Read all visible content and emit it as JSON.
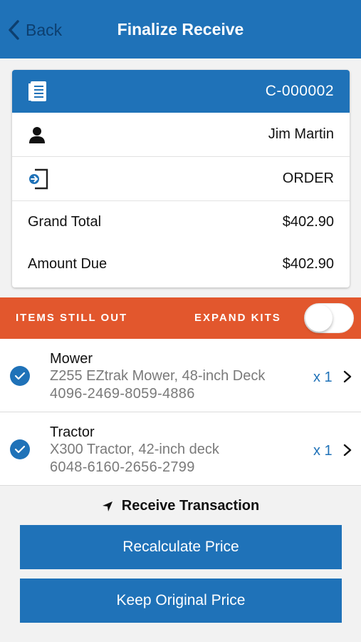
{
  "nav": {
    "back_label": "Back",
    "title": "Finalize Receive"
  },
  "summary": {
    "contract_number": "C-000002",
    "customer_name": "Jim Martin",
    "transaction_type": "ORDER",
    "grand_total_label": "Grand Total",
    "grand_total_value": "$402.90",
    "amount_due_label": "Amount Due",
    "amount_due_value": "$402.90",
    "icons": [
      "document-icon",
      "person-icon",
      "sign-in-icon"
    ]
  },
  "section": {
    "items_label": "ITEMS STILL OUT",
    "expand_kits_label": "EXPAND KITS",
    "expand_kits_on": false
  },
  "items": [
    {
      "name": "Mower",
      "description": "Z255 EZtrak Mower, 48-inch Deck",
      "serial": "4096-2469-8059-4886",
      "qty": "x 1",
      "checked": true
    },
    {
      "name": "Tractor",
      "description": "X300 Tractor, 42-inch deck",
      "serial": "6048-6160-2656-2799",
      "qty": "x 1",
      "checked": true
    }
  ],
  "footer": {
    "receive_label": "Receive Transaction",
    "recalculate_label": "Recalculate Price",
    "keep_label": "Keep Original Price"
  },
  "colors": {
    "primary": "#1f72b8",
    "accent": "#e2572d",
    "background": "#f2f2f2"
  }
}
